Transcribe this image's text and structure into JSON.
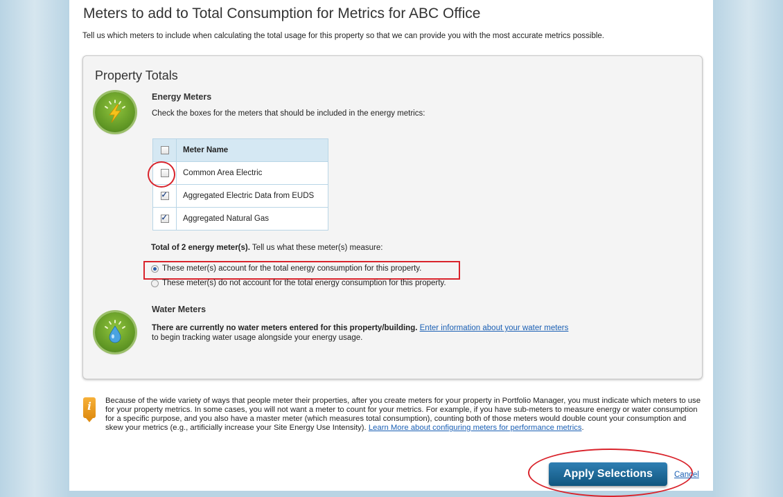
{
  "page": {
    "title": "Meters to add to Total Consumption for Metrics for ABC Office",
    "subtitle": "Tell us which meters to include when calculating the total usage for this property so that we can provide you with the most accurate metrics possible."
  },
  "property_totals": {
    "title": "Property Totals",
    "energy": {
      "heading": "Energy Meters",
      "instruction": "Check the boxes for the meters that should be included in the energy metrics:",
      "table_header": "Meter Name",
      "select_all_checked": false,
      "meters": [
        {
          "name": "Common Area Electric",
          "checked": false
        },
        {
          "name": "Aggregated Electric Data from EUDS",
          "checked": true
        },
        {
          "name": "Aggregated Natural Gas",
          "checked": true
        }
      ],
      "total_bold": "Total of 2 energy meter(s).",
      "total_rest": " Tell us what these meter(s) measure:",
      "options": [
        {
          "label": "These meter(s) account for the total energy consumption for this property.",
          "selected": true
        },
        {
          "label": "These meter(s) do not account for the total energy consumption for this property.",
          "selected": false
        }
      ]
    },
    "water": {
      "heading": "Water Meters",
      "notice_bold": "There are currently no water meters entered for this property/building.",
      "link": "Enter information about your water meters",
      "notice_rest": "to begin tracking water usage alongside your energy usage."
    }
  },
  "info": {
    "text": "Because of the wide variety of ways that people meter their properties, after you create meters for your property in Portfolio Manager, you must indicate which meters to use for your property metrics. In some cases, you will not want a meter to count for your metrics. For example, if you have sub-meters to measure energy or water consumption for a specific purpose, and you also have a master meter (which measures total consumption), counting both of those meters would double count your consumption and skew your metrics (e.g., artificially increase your Site Energy Use Intensity). ",
    "link": "Learn More about configuring meters for performance metrics",
    "end": "."
  },
  "actions": {
    "apply_label": "Apply Selections",
    "cancel_label": "Cancel"
  },
  "colors": {
    "annotation_red": "#d9232b",
    "button_blue": "#1d6a99",
    "table_header": "#d5e8f3"
  }
}
